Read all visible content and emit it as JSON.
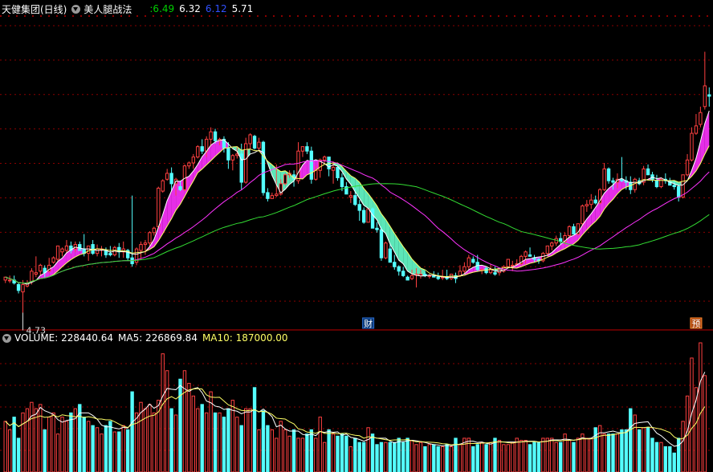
{
  "header": {
    "stock_label": "天健集团(日线)",
    "indicator": "美人腿战法",
    "values": [
      {
        "text": ":6.49",
        "color": "#00d000"
      },
      {
        "text": "6.32",
        "color": "#ffffff"
      },
      {
        "text": "6.12",
        "color": "#3050ff"
      },
      {
        "text": "5.71",
        "color": "#ffffff"
      }
    ]
  },
  "volume_header": {
    "label": "VOLUME: 228440.64",
    "ma5": "MA5: 226869.84",
    "ma10": "MA10: 187000.00"
  },
  "markers": {
    "low_label": "4.73",
    "finance_badge": "财",
    "forecast_badge": "预"
  },
  "colors": {
    "up": "#ff4040",
    "down": "#54ffff",
    "grid": "#8b0000",
    "ma_short": "#ffffff",
    "ma_mid": "#ffff66",
    "ma_long": "#ff33ff",
    "ma_longest": "#33dd33",
    "ribbon_up": "#ff33ff",
    "ribbon_down": "#66ffcc"
  },
  "chart_data": {
    "type": "candlestick",
    "price_range": [
      4.63,
      6.72
    ],
    "volume_range": [
      0,
      308000
    ],
    "candles": [
      [
        4.95,
        4.97,
        4.93,
        4.97
      ],
      [
        4.95,
        4.98,
        4.93,
        4.95
      ],
      [
        4.95,
        4.98,
        4.92,
        4.93
      ],
      [
        4.92,
        4.93,
        4.86,
        4.88
      ],
      [
        4.87,
        4.95,
        4.73,
        4.92
      ],
      [
        4.91,
        4.95,
        4.9,
        4.93
      ],
      [
        4.94,
        5.03,
        4.92,
        5.01
      ],
      [
        4.99,
        5.11,
        4.97,
        5.0
      ],
      [
        5.01,
        5.06,
        4.98,
        5.05
      ],
      [
        5.03,
        5.05,
        4.97,
        5.0
      ],
      [
        5.01,
        5.1,
        5.0,
        5.05
      ],
      [
        5.07,
        5.11,
        5.06,
        5.1
      ],
      [
        5.09,
        5.18,
        5.07,
        5.18
      ],
      [
        5.14,
        5.17,
        5.11,
        5.16
      ],
      [
        5.15,
        5.22,
        5.13,
        5.18
      ],
      [
        5.18,
        5.21,
        5.13,
        5.15
      ],
      [
        5.16,
        5.21,
        5.14,
        5.19
      ],
      [
        5.19,
        5.21,
        5.15,
        5.15
      ],
      [
        5.16,
        5.26,
        5.11,
        5.13
      ],
      [
        5.13,
        5.18,
        5.08,
        5.18
      ],
      [
        5.19,
        5.22,
        5.12,
        5.13
      ],
      [
        5.13,
        5.19,
        5.11,
        5.16
      ],
      [
        5.16,
        5.18,
        5.11,
        5.16
      ],
      [
        5.15,
        5.17,
        5.1,
        5.12
      ],
      [
        5.13,
        5.18,
        5.11,
        5.12
      ],
      [
        5.12,
        5.18,
        5.11,
        5.17
      ],
      [
        5.17,
        5.2,
        5.1,
        5.14
      ],
      [
        5.14,
        5.21,
        5.1,
        5.16
      ],
      [
        5.15,
        5.16,
        5.08,
        5.1
      ],
      [
        5.1,
        5.52,
        5.04,
        5.06
      ],
      [
        5.07,
        5.17,
        5.05,
        5.16
      ],
      [
        5.15,
        5.21,
        5.09,
        5.19
      ],
      [
        5.19,
        5.22,
        5.12,
        5.2
      ],
      [
        5.2,
        5.28,
        5.18,
        5.27
      ],
      [
        5.27,
        5.31,
        5.25,
        5.3
      ],
      [
        5.31,
        5.58,
        5.29,
        5.57
      ],
      [
        5.55,
        5.63,
        5.54,
        5.62
      ],
      [
        5.63,
        5.7,
        5.62,
        5.67
      ],
      [
        5.67,
        5.71,
        5.55,
        5.6
      ],
      [
        5.6,
        5.64,
        5.52,
        5.63
      ],
      [
        5.58,
        5.62,
        5.55,
        5.56
      ],
      [
        5.56,
        5.73,
        5.55,
        5.72
      ],
      [
        5.72,
        5.75,
        5.7,
        5.74
      ],
      [
        5.74,
        5.8,
        5.7,
        5.78
      ],
      [
        5.78,
        5.86,
        5.77,
        5.85
      ],
      [
        5.85,
        5.9,
        5.8,
        5.82
      ],
      [
        5.82,
        5.92,
        5.78,
        5.9
      ],
      [
        5.9,
        5.98,
        5.85,
        5.95
      ],
      [
        5.95,
        5.97,
        5.87,
        5.89
      ],
      [
        5.89,
        5.91,
        5.86,
        5.9
      ],
      [
        5.9,
        5.92,
        5.81,
        5.84
      ],
      [
        5.84,
        5.88,
        5.7,
        5.76
      ],
      [
        5.76,
        5.8,
        5.69,
        5.79
      ],
      [
        5.79,
        5.85,
        5.77,
        5.8
      ],
      [
        5.8,
        5.87,
        5.56,
        5.61
      ],
      [
        5.61,
        5.91,
        5.6,
        5.87
      ],
      [
        5.87,
        5.94,
        5.83,
        5.93
      ],
      [
        5.92,
        5.93,
        5.83,
        5.84
      ],
      [
        5.84,
        5.91,
        5.82,
        5.88
      ],
      [
        5.88,
        5.89,
        5.52,
        5.54
      ],
      [
        5.54,
        5.57,
        5.48,
        5.5
      ],
      [
        5.5,
        5.54,
        5.5,
        5.52
      ],
      [
        5.52,
        5.73,
        5.51,
        5.53
      ],
      [
        5.53,
        5.63,
        5.52,
        5.6
      ],
      [
        5.6,
        5.67,
        5.59,
        5.66
      ],
      [
        5.66,
        5.69,
        5.64,
        5.67
      ],
      [
        5.66,
        5.69,
        5.58,
        5.63
      ],
      [
        5.62,
        5.88,
        5.6,
        5.82
      ],
      [
        5.82,
        5.85,
        5.78,
        5.85
      ],
      [
        5.85,
        5.88,
        5.8,
        5.82
      ],
      [
        5.82,
        5.85,
        5.6,
        5.63
      ],
      [
        5.63,
        5.72,
        5.62,
        5.69
      ],
      [
        5.69,
        5.77,
        5.64,
        5.76
      ],
      [
        5.76,
        5.79,
        5.74,
        5.78
      ],
      [
        5.78,
        5.78,
        5.65,
        5.7
      ],
      [
        5.69,
        5.75,
        5.6,
        5.71
      ],
      [
        5.71,
        5.72,
        5.62,
        5.64
      ],
      [
        5.64,
        5.67,
        5.55,
        5.58
      ],
      [
        5.58,
        5.61,
        5.53,
        5.53
      ],
      [
        5.51,
        5.55,
        5.47,
        5.52
      ],
      [
        5.52,
        5.57,
        5.45,
        5.46
      ],
      [
        5.46,
        5.49,
        5.35,
        5.42
      ],
      [
        5.42,
        5.44,
        5.33,
        5.34
      ],
      [
        5.34,
        5.43,
        5.34,
        5.43
      ],
      [
        5.43,
        5.44,
        5.3,
        5.3
      ],
      [
        5.3,
        5.34,
        5.27,
        5.29
      ],
      [
        5.29,
        5.31,
        5.08,
        5.1
      ],
      [
        5.1,
        5.21,
        5.09,
        5.2
      ],
      [
        5.16,
        5.19,
        5.07,
        5.07
      ],
      [
        5.07,
        5.12,
        5.02,
        5.04
      ],
      [
        5.04,
        5.05,
        4.98,
        5.01
      ],
      [
        5.01,
        5.04,
        4.97,
        4.98
      ],
      [
        4.97,
        4.98,
        4.95,
        4.95
      ],
      [
        4.96,
        5.02,
        4.95,
        4.98
      ],
      [
        4.99,
        5.03,
        4.9,
        4.99
      ],
      [
        4.98,
        5.02,
        4.96,
        4.99
      ],
      [
        4.99,
        5.01,
        4.97,
        4.98
      ],
      [
        4.98,
        4.99,
        4.96,
        4.98
      ],
      [
        4.98,
        5.01,
        4.97,
        4.97
      ],
      [
        4.97,
        5.0,
        4.95,
        4.96
      ],
      [
        4.97,
        5.02,
        4.95,
        4.97
      ],
      [
        4.97,
        5.02,
        4.95,
        4.96
      ],
      [
        4.96,
        4.99,
        4.95,
        4.99
      ],
      [
        4.98,
        5.0,
        4.93,
        4.96
      ],
      [
        4.98,
        5.05,
        4.97,
        5.01
      ],
      [
        5.01,
        5.07,
        4.99,
        5.04
      ],
      [
        5.04,
        5.12,
        5.02,
        5.1
      ],
      [
        5.09,
        5.11,
        5.06,
        5.07
      ],
      [
        5.07,
        5.12,
        5.01,
        5.02
      ],
      [
        5.02,
        5.03,
        4.99,
        5.02
      ],
      [
        5.03,
        5.04,
        4.99,
        5.0
      ],
      [
        5.0,
        5.06,
        4.99,
        5.02
      ],
      [
        5.0,
        5.04,
        4.98,
        4.99
      ],
      [
        5.0,
        5.02,
        4.98,
        5.02
      ],
      [
        5.01,
        5.05,
        5.0,
        5.04
      ],
      [
        5.04,
        5.09,
        5.03,
        5.09
      ],
      [
        5.05,
        5.08,
        5.01,
        5.05
      ],
      [
        5.06,
        5.09,
        5.05,
        5.06
      ],
      [
        5.06,
        5.12,
        5.05,
        5.11
      ],
      [
        5.11,
        5.15,
        5.06,
        5.14
      ],
      [
        5.12,
        5.17,
        5.11,
        5.11
      ],
      [
        5.1,
        5.12,
        5.07,
        5.09
      ],
      [
        5.09,
        5.1,
        5.06,
        5.08
      ],
      [
        5.08,
        5.14,
        5.07,
        5.13
      ],
      [
        5.13,
        5.18,
        5.11,
        5.18
      ],
      [
        5.18,
        5.21,
        5.15,
        5.2
      ],
      [
        5.2,
        5.25,
        5.18,
        5.23
      ],
      [
        5.23,
        5.27,
        5.19,
        5.21
      ],
      [
        5.21,
        5.27,
        5.19,
        5.25
      ],
      [
        5.25,
        5.32,
        5.23,
        5.31
      ],
      [
        5.31,
        5.33,
        5.26,
        5.26
      ],
      [
        5.26,
        5.33,
        5.25,
        5.33
      ],
      [
        5.33,
        5.46,
        5.31,
        5.45
      ],
      [
        5.45,
        5.49,
        5.41,
        5.46
      ],
      [
        5.46,
        5.53,
        5.43,
        5.49
      ],
      [
        5.49,
        5.52,
        5.46,
        5.47
      ],
      [
        5.47,
        5.57,
        5.46,
        5.56
      ],
      [
        5.56,
        5.74,
        5.55,
        5.7
      ],
      [
        5.7,
        5.71,
        5.6,
        5.62
      ],
      [
        5.62,
        5.64,
        5.56,
        5.61
      ],
      [
        5.61,
        5.67,
        5.57,
        5.63
      ],
      [
        5.63,
        5.78,
        5.61,
        5.62
      ],
      [
        5.62,
        5.65,
        5.56,
        5.61
      ],
      [
        5.61,
        5.65,
        5.53,
        5.56
      ],
      [
        5.56,
        5.64,
        5.54,
        5.63
      ],
      [
        5.62,
        5.64,
        5.59,
        5.6
      ],
      [
        5.61,
        5.72,
        5.59,
        5.7
      ],
      [
        5.7,
        5.73,
        5.66,
        5.66
      ],
      [
        5.66,
        5.68,
        5.61,
        5.63
      ],
      [
        5.62,
        5.66,
        5.57,
        5.58
      ],
      [
        5.58,
        5.64,
        5.57,
        5.63
      ],
      [
        5.63,
        5.67,
        5.6,
        5.62
      ],
      [
        5.62,
        5.64,
        5.59,
        5.59
      ],
      [
        5.59,
        5.62,
        5.56,
        5.58
      ],
      [
        5.58,
        5.6,
        5.48,
        5.51
      ],
      [
        5.51,
        5.66,
        5.5,
        5.66
      ],
      [
        5.66,
        5.8,
        5.65,
        5.76
      ],
      [
        5.76,
        5.98,
        5.75,
        5.94
      ],
      [
        5.94,
        6.07,
        5.93,
        5.99
      ],
      [
        6.0,
        6.12,
        5.98,
        6.08
      ],
      [
        6.12,
        6.49,
        6.1,
        6.26
      ],
      [
        6.2,
        6.25,
        6.12,
        6.19
      ]
    ],
    "volume": [
      120000,
      100000,
      130000,
      80000,
      140000,
      150000,
      165000,
      150000,
      160000,
      100000,
      130000,
      140000,
      90000,
      130000,
      120000,
      140000,
      150000,
      160000,
      130000,
      120000,
      110000,
      105000,
      90000,
      110000,
      120000,
      95000,
      95000,
      110000,
      100000,
      190000,
      140000,
      165000,
      150000,
      160000,
      140000,
      170000,
      280000,
      240000,
      150000,
      135000,
      220000,
      240000,
      210000,
      180000,
      150000,
      160000,
      140000,
      190000,
      140000,
      140000,
      130000,
      150000,
      170000,
      130000,
      110000,
      150000,
      150000,
      200000,
      100000,
      145000,
      110000,
      100000,
      80000,
      120000,
      100000,
      85000,
      100000,
      80000,
      80000,
      90000,
      100000,
      80000,
      130000,
      70000,
      100000,
      90000,
      85000,
      90000,
      85000,
      60000,
      80000,
      70000,
      70000,
      105000,
      90000,
      65000,
      70000,
      70000,
      70000,
      70000,
      80000,
      70000,
      80000,
      75000,
      65000,
      70000,
      60000,
      65000,
      65000,
      60000,
      60000,
      65000,
      60000,
      80000,
      65000,
      80000,
      80000,
      60000,
      65000,
      70000,
      65000,
      70000,
      80000,
      75000,
      65000,
      65000,
      70000,
      80000,
      75000,
      75000,
      65000,
      70000,
      70000,
      80000,
      80000,
      80000,
      70000,
      70000,
      90000,
      75000,
      70000,
      80000,
      90000,
      80000,
      80000,
      105000,
      110000,
      90000,
      90000,
      90000,
      90000,
      100000,
      100000,
      150000,
      135000,
      100000,
      105000,
      105000,
      80000,
      70000,
      70000,
      60000,
      60000,
      45000,
      80000,
      120000,
      180000,
      270000,
      200000,
      306000,
      228440
    ]
  }
}
